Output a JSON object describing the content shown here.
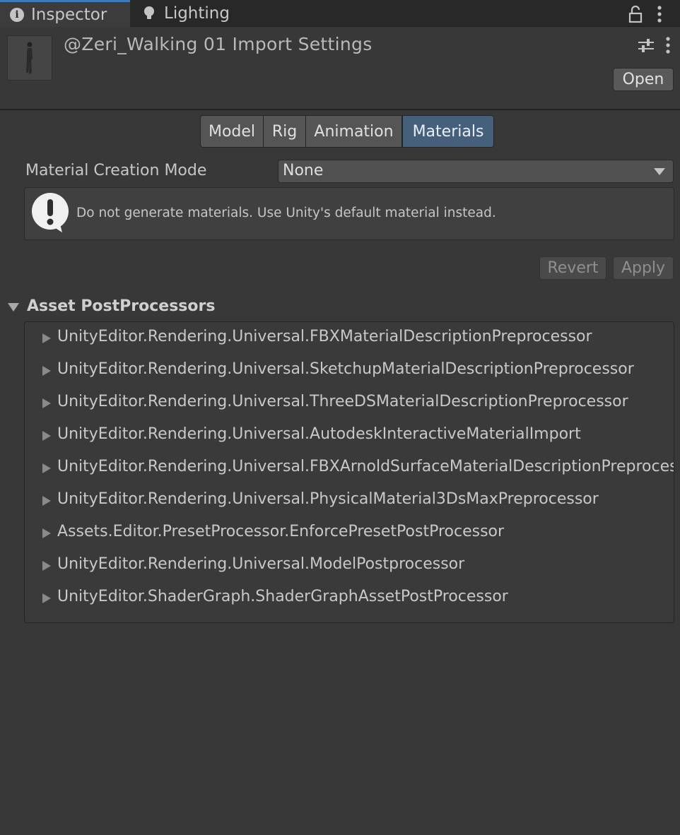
{
  "tabs": {
    "inspector": "Inspector",
    "lighting": "Lighting"
  },
  "header": {
    "title": "@Zeri_Walking 01 Import Settings",
    "open_label": "Open"
  },
  "import_tabs": [
    "Model",
    "Rig",
    "Animation",
    "Materials"
  ],
  "materials": {
    "creation_mode_label": "Material Creation Mode",
    "creation_mode_value": "None",
    "help_text": "Do not generate materials. Use Unity's default material instead."
  },
  "actions": {
    "revert": "Revert",
    "apply": "Apply"
  },
  "postprocessors": {
    "title": "Asset PostProcessors",
    "items": [
      "UnityEditor.Rendering.Universal.FBXMaterialDescriptionPreprocessor",
      "UnityEditor.Rendering.Universal.SketchupMaterialDescriptionPreprocessor",
      "UnityEditor.Rendering.Universal.ThreeDSMaterialDescriptionPreprocessor",
      "UnityEditor.Rendering.Universal.AutodeskInteractiveMaterialImport",
      "UnityEditor.Rendering.Universal.FBXArnoldSurfaceMaterialDescriptionPreprocessor",
      "UnityEditor.Rendering.Universal.PhysicalMaterial3DsMaxPreprocessor",
      "Assets.Editor.PresetProcessor.EnforcePresetPostProcessor",
      "UnityEditor.Rendering.Universal.ModelPostprocessor",
      "UnityEditor.ShaderGraph.ShaderGraphAssetPostProcessor"
    ]
  },
  "colors": {
    "background": "#383838",
    "selected_tab": "#46607c",
    "active_tab_accent": "#3a79bb"
  },
  "icons": [
    "info-icon",
    "lightbulb-icon",
    "lock-icon",
    "kebab-menu-icon",
    "sliders-icon",
    "warning-icon",
    "dropdown-caret-icon",
    "foldout-triangle-icon"
  ]
}
